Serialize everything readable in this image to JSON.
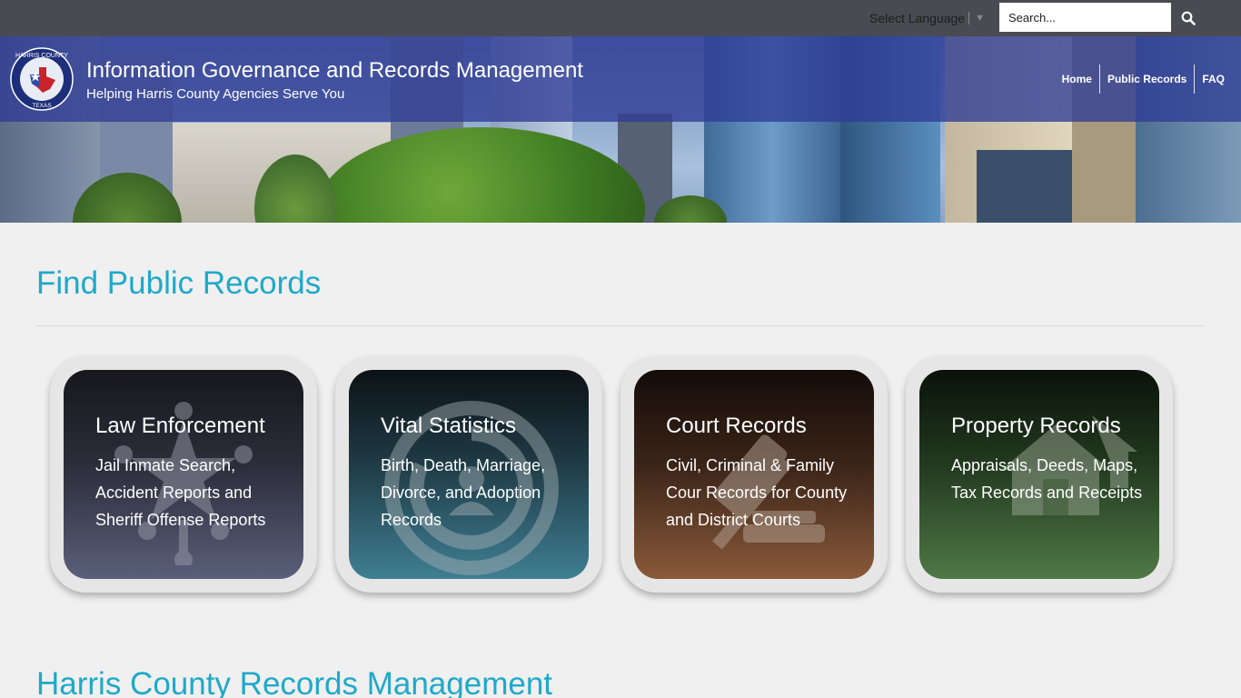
{
  "topbar": {
    "language_label": "Select Language",
    "search_placeholder": "Search..."
  },
  "header": {
    "title": "Information Governance and Records Management",
    "subtitle": "Helping Harris County Agencies Serve You",
    "logo_text_top": "HARRIS COUNTY",
    "logo_text_bottom": "TEXAS",
    "nav": [
      {
        "label": "Home"
      },
      {
        "label": "Public Records"
      },
      {
        "label": "FAQ"
      }
    ]
  },
  "main": {
    "section_title": "Find Public Records",
    "next_section_title": "Harris County Records Management",
    "cards": [
      {
        "title": "Law Enforcement",
        "description": "Jail Inmate Search, Accident Reports and Sheriff Offense Reports",
        "icon": "sheriff-badge-icon",
        "color_top": "#17171c",
        "color_bottom": "#5a5f7a"
      },
      {
        "title": "Vital Statistics",
        "description": "Birth, Death, Marriage, Divorce, and Adoption Records",
        "icon": "family-circle-icon",
        "color_top": "#0c1216",
        "color_bottom": "#3f7f92"
      },
      {
        "title": "Court Records",
        "description": "Civil, Criminal & Family Cour Records for County and District Courts",
        "icon": "gavel-icon",
        "color_top": "#140c08",
        "color_bottom": "#8a5a3a"
      },
      {
        "title": "Property Records",
        "description": "Appraisals, Deeds, Maps, Tax Records and Receipts",
        "icon": "house-icon",
        "color_top": "#0a120a",
        "color_bottom": "#4f7846"
      }
    ]
  },
  "colors": {
    "accent": "#1fa9c9",
    "topbar": "#4a4b52",
    "header_band": "#2f3c96"
  }
}
